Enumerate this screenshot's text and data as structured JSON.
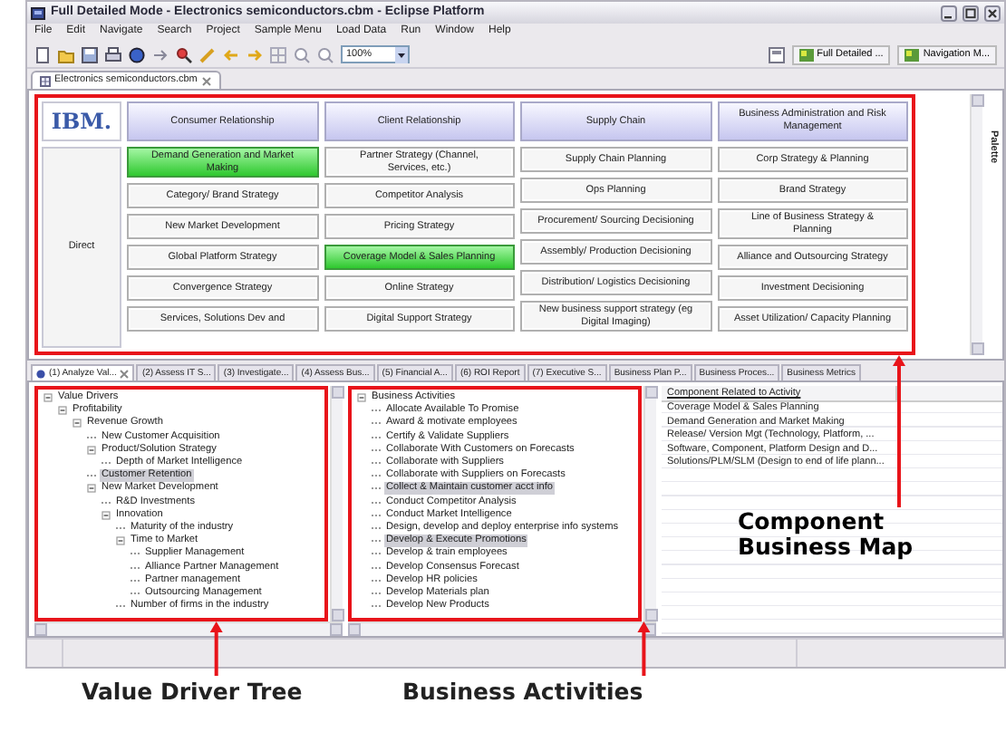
{
  "window": {
    "title": "Full Detailed Mode - Electronics semiconductors.cbm - Eclipse Platform"
  },
  "menu": [
    "File",
    "Edit",
    "Navigate",
    "Search",
    "Project",
    "Sample Menu",
    "Load Data",
    "Run",
    "Window",
    "Help"
  ],
  "toolbar": {
    "zoom": "100%",
    "perspectives": [
      "Full Detailed ...",
      "Navigation M..."
    ]
  },
  "editor_tab": {
    "label": "Electronics semiconductors.cbm"
  },
  "component_map": {
    "logo": "IBM.",
    "row_label": "Direct",
    "callout": "Component Business Map",
    "columns": [
      {
        "heading": "Consumer Relationship",
        "components": [
          {
            "label": "Demand Generation and Market Making",
            "highlighted": true
          },
          {
            "label": "Category/ Brand Strategy",
            "highlighted": false
          },
          {
            "label": "New Market Development",
            "highlighted": false
          },
          {
            "label": "Global Platform Strategy",
            "highlighted": false
          },
          {
            "label": "Convergence Strategy",
            "highlighted": false
          },
          {
            "label": "Services, Solutions Dev and",
            "highlighted": false
          }
        ]
      },
      {
        "heading": "Client Relationship",
        "components": [
          {
            "label": "Partner Strategy (Channel, Services, etc.)",
            "highlighted": false
          },
          {
            "label": "Competitor Analysis",
            "highlighted": false
          },
          {
            "label": "Pricing Strategy",
            "highlighted": false
          },
          {
            "label": "Coverage Model & Sales Planning",
            "highlighted": true
          },
          {
            "label": "Online Strategy",
            "highlighted": false
          },
          {
            "label": "Digital Support Strategy",
            "highlighted": false
          }
        ]
      },
      {
        "heading": "Supply Chain",
        "components": [
          {
            "label": "Supply Chain Planning",
            "highlighted": false
          },
          {
            "label": "Ops Planning",
            "highlighted": false
          },
          {
            "label": "Procurement/ Sourcing Decisioning",
            "highlighted": false
          },
          {
            "label": "Assembly/ Production Decisioning",
            "highlighted": false
          },
          {
            "label": "Distribution/ Logistics Decisioning",
            "highlighted": false
          },
          {
            "label": "New business support strategy (eg Digital Imaging)",
            "highlighted": false
          }
        ]
      },
      {
        "heading": "Business Administration and Risk Management",
        "components": [
          {
            "label": "Corp Strategy & Planning",
            "highlighted": false
          },
          {
            "label": "Brand Strategy",
            "highlighted": false
          },
          {
            "label": "Line of Business Strategy & Planning",
            "highlighted": false
          },
          {
            "label": "Alliance and Outsourcing Strategy",
            "highlighted": false
          },
          {
            "label": "Investment Decisioning",
            "highlighted": false
          },
          {
            "label": "Asset Utilization/ Capacity Planning",
            "highlighted": false
          }
        ]
      }
    ]
  },
  "palette": {
    "label": "Palette"
  },
  "view_tabs": [
    {
      "label": "(1) Analyze Val...",
      "selected": true
    },
    {
      "label": "(2) Assess IT S...",
      "selected": false
    },
    {
      "label": "(3) Investigate...",
      "selected": false
    },
    {
      "label": "(4) Assess Bus...",
      "selected": false
    },
    {
      "label": "(5) Financial A...",
      "selected": false
    },
    {
      "label": "(6) ROI Report",
      "selected": false
    },
    {
      "label": "(7) Executive S...",
      "selected": false
    },
    {
      "label": "Business Plan P...",
      "selected": false
    },
    {
      "label": "Business Proces...",
      "selected": false
    },
    {
      "label": "Business Metrics",
      "selected": false
    }
  ],
  "value_driver_tree": {
    "callout": "Value Driver Tree",
    "items": [
      {
        "label": "Value Drivers",
        "selected": false,
        "expanded": true,
        "children": [
          {
            "label": "Profitability",
            "selected": false,
            "expanded": true,
            "children": [
              {
                "label": "Revenue Growth",
                "selected": false,
                "expanded": true,
                "children": [
                  {
                    "label": "New Customer Acquisition",
                    "selected": false
                  },
                  {
                    "label": "Product/Solution Strategy",
                    "selected": false,
                    "expanded": true,
                    "children": [
                      {
                        "label": "Depth of Market Intelligence",
                        "selected": false
                      }
                    ]
                  },
                  {
                    "label": "Customer Retention",
                    "selected": true
                  },
                  {
                    "label": "New Market Development",
                    "selected": false,
                    "expanded": true,
                    "children": [
                      {
                        "label": "R&D Investments",
                        "selected": false
                      },
                      {
                        "label": "Innovation",
                        "selected": false,
                        "expanded": true,
                        "children": [
                          {
                            "label": "Maturity of the industry",
                            "selected": false
                          },
                          {
                            "label": "Time to Market",
                            "selected": false,
                            "expanded": true,
                            "children": [
                              {
                                "label": "Supplier Management",
                                "selected": false
                              },
                              {
                                "label": "Alliance Partner Management",
                                "selected": false
                              },
                              {
                                "label": "Partner management",
                                "selected": false
                              },
                              {
                                "label": "Outsourcing Management",
                                "selected": false
                              }
                            ]
                          },
                          {
                            "label": "Number of firms in the industry",
                            "selected": false
                          }
                        ]
                      }
                    ]
                  }
                ]
              }
            ]
          }
        ]
      }
    ]
  },
  "business_activities": {
    "callout": "Business Activities",
    "items": [
      {
        "label": "Business Activities",
        "selected": false,
        "expanded": true,
        "children": [
          {
            "label": "Allocate Available To Promise",
            "selected": false
          },
          {
            "label": "Award & motivate employees",
            "selected": false
          },
          {
            "label": "Certify & Validate Suppliers",
            "selected": false
          },
          {
            "label": "Collaborate With Customers on Forecasts",
            "selected": false
          },
          {
            "label": "Collaborate with Suppliers",
            "selected": false
          },
          {
            "label": "Collaborate with Suppliers on Forecasts",
            "selected": false
          },
          {
            "label": "Collect & Maintain customer acct info",
            "selected": true
          },
          {
            "label": "Conduct Competitor Analysis",
            "selected": false
          },
          {
            "label": "Conduct Market Intelligence",
            "selected": false
          },
          {
            "label": "Design, develop and deploy enterprise info systems",
            "selected": false
          },
          {
            "label": "Develop & Execute Promotions",
            "selected": true
          },
          {
            "label": "Develop & train employees",
            "selected": false
          },
          {
            "label": "Develop Consensus Forecast",
            "selected": false
          },
          {
            "label": "Develop HR policies",
            "selected": false
          },
          {
            "label": "Develop Materials plan",
            "selected": false
          },
          {
            "label": "Develop New Products",
            "selected": false
          }
        ]
      }
    ]
  },
  "component_table": {
    "column": "Component Related to Activity",
    "rows": [
      "Coverage Model & Sales Planning",
      "Demand Generation and Market Making",
      "Release/ Version Mgt (Technology, Platform, ...",
      "Software, Component, Platform Design and D...",
      "Solutions/PLM/SLM (Design to end of life plann..."
    ]
  }
}
